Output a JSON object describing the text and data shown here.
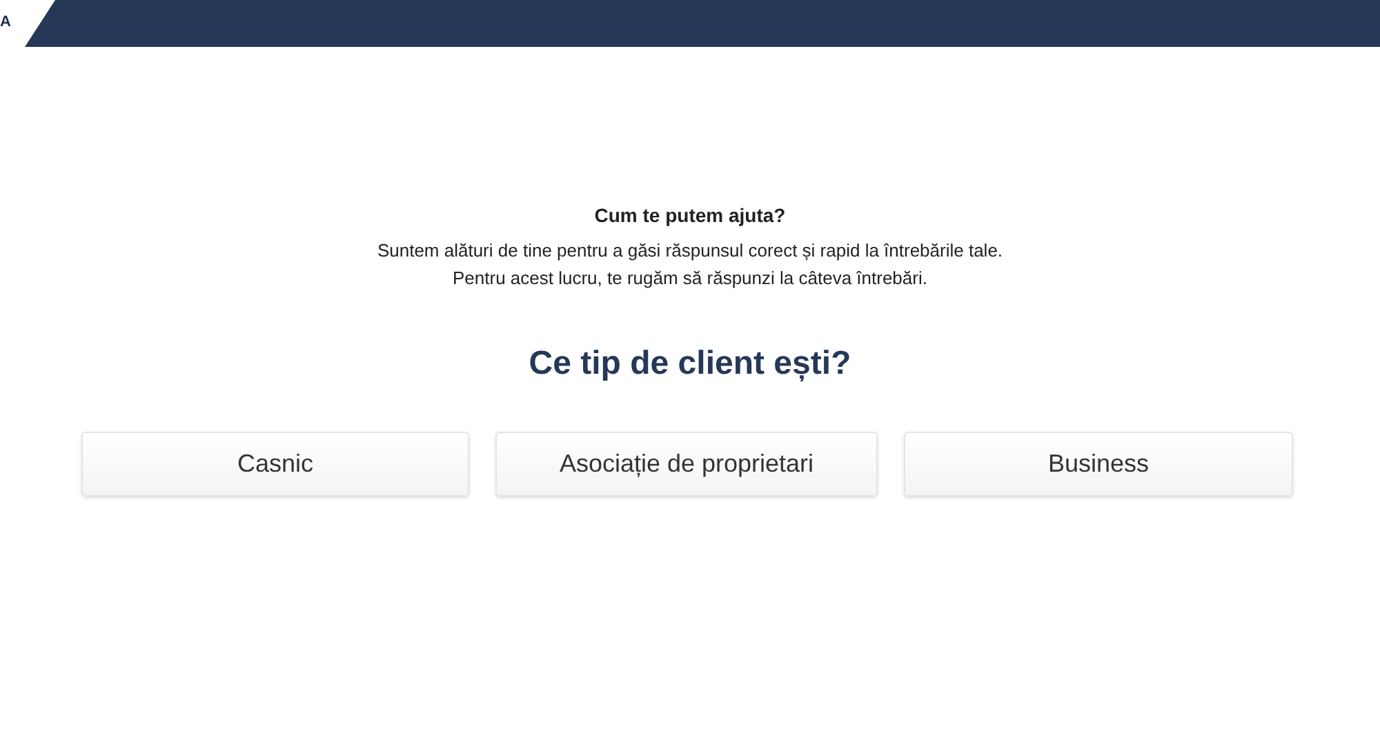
{
  "header": {
    "logo_text": "A"
  },
  "intro": {
    "title": "Cum te putem ajuta?",
    "lines": [
      "Suntem alături de tine pentru a găsi răspunsul corect și rapid la întrebările tale.",
      "Pentru acest lucru, te rugăm să răspunzi la câteva întrebări."
    ]
  },
  "question": "Ce tip de client ești?",
  "options": [
    {
      "label": "Casnic",
      "selected": false
    },
    {
      "label": "Asociație de proprietari",
      "selected": false
    },
    {
      "label": "Business",
      "selected": false
    }
  ]
}
